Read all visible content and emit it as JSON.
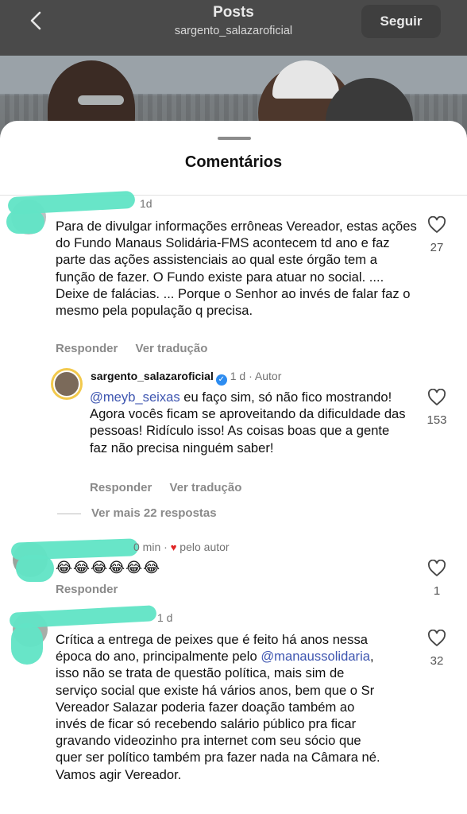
{
  "header": {
    "title": "Posts",
    "subtitle": "sargento_salazaroficial",
    "follow_label": "Seguir"
  },
  "sheet": {
    "title": "Comentários"
  },
  "comments": [
    {
      "time": "1d",
      "text": "Para de divulgar informações errôneas Vereador, estas ações do Fundo Manaus Solidária-FMS acontecem td ano e faz parte das ações assistenciais ao qual este órgão tem a função de fazer. O Fundo existe para atuar no social. .... Deixe de falácias. ... Porque o Senhor ao invés de falar faz o mesmo pela população q precisa.",
      "reply_label": "Responder",
      "translate_label": "Ver tradução",
      "likes": "27"
    }
  ],
  "reply": {
    "username": "sargento_salazaroficial",
    "time": "1 d",
    "badge": "Autor",
    "mention": "@meyb_seixas",
    "text": " eu faço sim, só não fico mostrando! Agora vocês ficam se aproveitando da dificuldade das pessoas! Ridículo isso! As coisas boas que a gente faz não precisa ninguém saber!",
    "reply_label": "Responder",
    "translate_label": "Ver tradução",
    "likes": "153"
  },
  "more_replies": "Ver mais 22 respostas",
  "comment2": {
    "time": "0 min",
    "liked_by": "pelo autor",
    "text": "😂😂😂😂😂😂",
    "reply_label": "Responder",
    "likes": "1"
  },
  "comment3": {
    "time": "1 d",
    "text_before": "Crítica a entrega de peixes que é feito há anos nessa época do ano, principalmente pelo ",
    "mention": "@manaussolidaria",
    "text_after": ", isso não se trata de questão política, mais sim de serviço social que existe há vários anos, bem que o Sr Vereador Salazar poderia fazer doação também ao invés de ficar só recebendo salário público pra ficar gravando videozinho pra internet com seu sócio que quer ser político também pra fazer nada na Câmara né. Vamos agir Vereador.",
    "likes": "32"
  },
  "icons": {
    "back": "chevron-left-icon",
    "like": "heart-outline-icon",
    "liked_by_author": "heart-filled-icon",
    "verified": "verified-badge-icon"
  },
  "colors": {
    "mention": "#3d55b0",
    "scribble": "#62e4c6",
    "verified": "#2d8cf0",
    "heart": "#e02424"
  }
}
